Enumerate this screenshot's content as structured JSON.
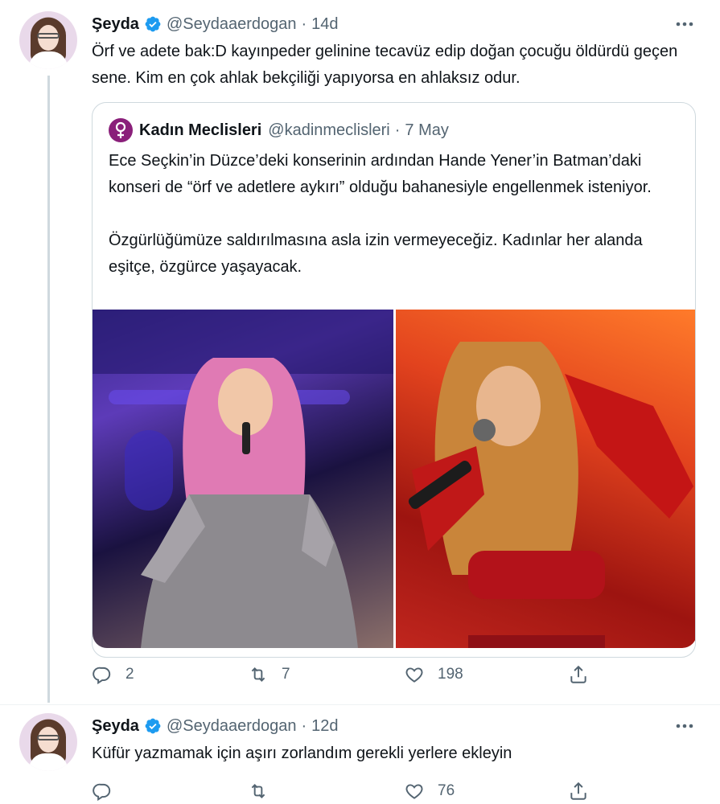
{
  "tweets": [
    {
      "author_name": "Şeyda",
      "handle": "@Seydaaerdogan",
      "separator": "·",
      "time": "14d",
      "text": "Örf ve adete bak:D kayınpeder gelinine tecavüz edip doğan çocuğu öldürdü geçen sene. Kim en çok ahlak bekçiliği yapıyorsa en ahlaksız odur.",
      "quote": {
        "author_name": "Kadın Meclisleri",
        "handle": "@kadinmeclisleri",
        "separator": "·",
        "time": "7 May",
        "paragraph1": "Ece Seçkin’in Düzce’deki konserinin ardından Hande Yener’in Batman’daki konseri de “örf ve adetlere aykırı” olduğu bahanesiyle engellenmek isteniyor.",
        "paragraph2": "Özgürlüğümüze saldırılmasına asla izin vermeyeceğiz. Kadınlar her alanda eşitçe, özgürce yaşayacak."
      },
      "actions": {
        "replies": "2",
        "retweets": "7",
        "likes": "198"
      }
    },
    {
      "author_name": "Şeyda",
      "handle": "@Seydaaerdogan",
      "separator": "·",
      "time": "12d",
      "text": "Küfür yazmamak için aşırı zorlandım gerekli yerlere ekleyin",
      "actions": {
        "replies": "",
        "retweets": "",
        "likes": "76"
      }
    }
  ],
  "icons": {
    "verified": "verified-badge-icon",
    "more": "more-options-icon",
    "reply": "reply-icon",
    "retweet": "retweet-icon",
    "like": "like-icon",
    "share": "share-icon"
  },
  "colors": {
    "verified_blue": "#1d9bf0",
    "text_primary": "#0f1419",
    "text_secondary": "#536471",
    "border": "#cfd9de",
    "quote_avatar": "#8a1f7a"
  }
}
